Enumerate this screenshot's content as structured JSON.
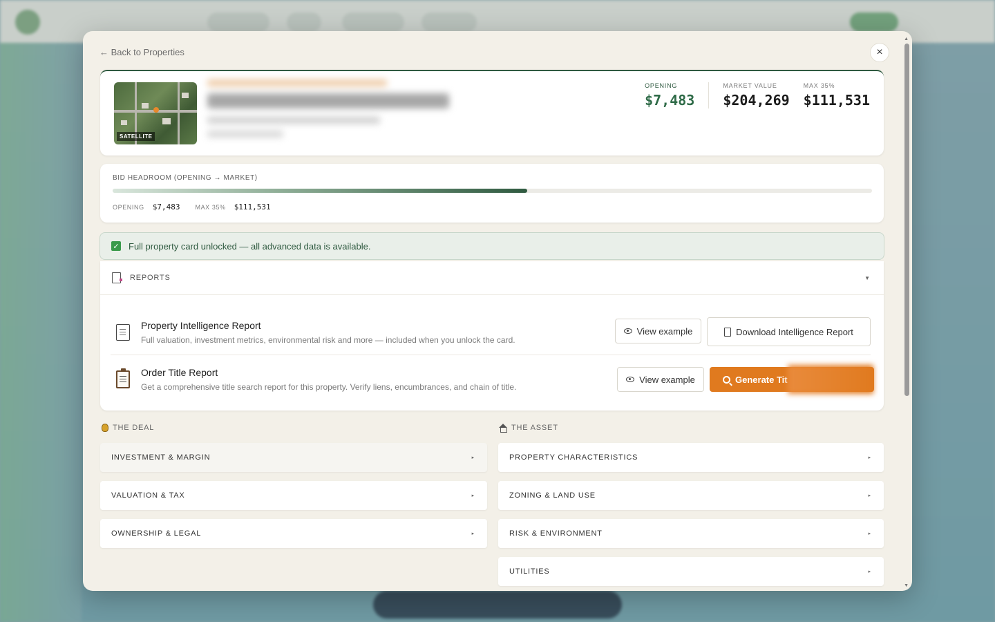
{
  "modal": {
    "back_label": "← Back to Properties",
    "close_label": "×"
  },
  "hero": {
    "satellite_label": "SATELLITE",
    "metrics": [
      {
        "label": "OPENING",
        "value": "$7,483"
      },
      {
        "label": "MARKET VALUE",
        "value": "$204,269"
      },
      {
        "label": "MAX 35%",
        "value": "$111,531"
      }
    ]
  },
  "headroom": {
    "title": "BID HEADROOM (OPENING → MARKET)",
    "fill_fraction": 0.546,
    "opening_label": "OPENING",
    "opening_value": "$7,483",
    "max_label": "MAX 35%",
    "max_value": "$111,531"
  },
  "unlocked": {
    "text": "Full property card unlocked — all advanced data is available."
  },
  "reports": {
    "title": "REPORTS",
    "caret": "▼",
    "items": [
      {
        "title": "Property Intelligence Report",
        "description": "Full valuation, investment metrics, environmental risk and more — included when you unlock the card.",
        "example_label": "View example",
        "action_label": "Download Intelligence Report"
      },
      {
        "title": "Order Title Report",
        "description": "Get a comprehensive title search report for this property. Verify liens, encumbrances, and chain of title.",
        "example_label": "View example",
        "action_label": "Generate Tit"
      }
    ]
  },
  "deal": {
    "title": "THE DEAL",
    "items": [
      "INVESTMENT & MARGIN",
      "VALUATION & TAX",
      "OWNERSHIP & LEGAL"
    ]
  },
  "asset": {
    "title": "THE ASSET",
    "items": [
      "PROPERTY CHARACTERISTICS",
      "ZONING & LAND USE",
      "RISK & ENVIRONMENT",
      "UTILITIES"
    ]
  },
  "chevron": "▸"
}
